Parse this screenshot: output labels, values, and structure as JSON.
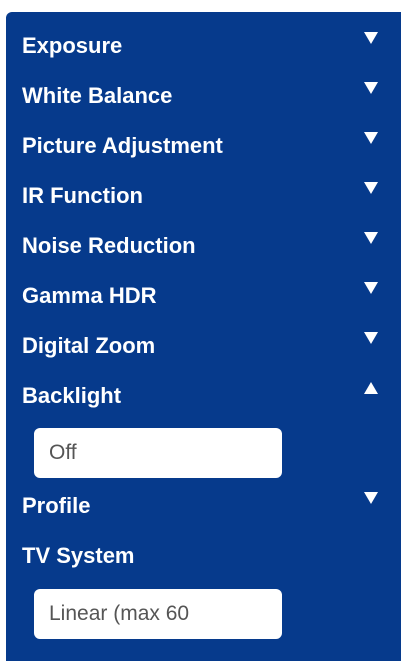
{
  "menu": {
    "items": [
      {
        "label": "Exposure",
        "state": "collapsed"
      },
      {
        "label": "White Balance",
        "state": "collapsed"
      },
      {
        "label": "Picture Adjustment",
        "state": "collapsed"
      },
      {
        "label": "IR Function",
        "state": "collapsed"
      },
      {
        "label": "Noise Reduction",
        "state": "collapsed"
      },
      {
        "label": "Gamma HDR",
        "state": "collapsed"
      },
      {
        "label": "Digital Zoom",
        "state": "collapsed"
      },
      {
        "label": "Backlight",
        "state": "expanded"
      },
      {
        "label": "Profile",
        "state": "collapsed"
      },
      {
        "label": "TV System",
        "state": "none"
      }
    ],
    "backlight_value": "Off",
    "tv_system_value": "Linear (max 60"
  },
  "colors": {
    "panel_bg": "#063a8c",
    "text": "#ffffff",
    "field_bg": "#ffffff",
    "field_text": "#555555"
  },
  "icons": {
    "collapsed": "triangle-down-icon",
    "expanded": "triangle-up-icon"
  }
}
